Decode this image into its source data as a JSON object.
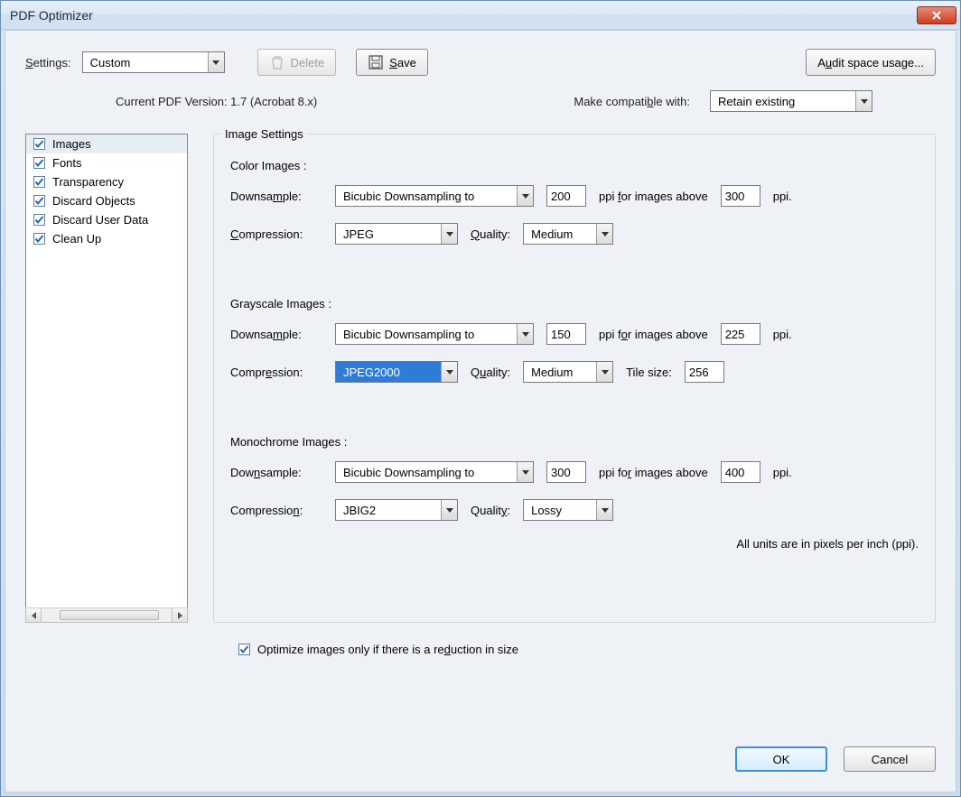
{
  "window": {
    "title": "PDF Optimizer"
  },
  "toolbar": {
    "settings_label": "Settings:",
    "settings_value": "Custom",
    "delete_label": "Delete",
    "save_label": "Save",
    "audit_label": "Audit space usage..."
  },
  "version": {
    "current_label": "Current PDF Version: 1.7 (Acrobat 8.x)",
    "compat_label": "Make compatible with:",
    "compat_value": "Retain existing"
  },
  "sidebar": {
    "items": [
      {
        "label": "Images",
        "checked": true,
        "selected": true
      },
      {
        "label": "Fonts",
        "checked": true,
        "selected": false
      },
      {
        "label": "Transparency",
        "checked": true,
        "selected": false
      },
      {
        "label": "Discard Objects",
        "checked": true,
        "selected": false
      },
      {
        "label": "Discard User Data",
        "checked": true,
        "selected": false
      },
      {
        "label": "Clean Up",
        "checked": true,
        "selected": false
      }
    ]
  },
  "panel": {
    "title": "Image Settings",
    "color_h": "Color Images :",
    "gray_h": "Grayscale Images :",
    "mono_h": "Monochrome Images :",
    "downsample_label": "Downsample:",
    "compression_label": "Compression:",
    "quality_label": "Quality:",
    "tile_label": "Tile size:",
    "ppi_for": "ppi for images above",
    "ppi_suffix": "ppi.",
    "color": {
      "downsample": "Bicubic Downsampling to",
      "ppi": "200",
      "above": "300",
      "compression": "JPEG",
      "quality": "Medium"
    },
    "gray": {
      "downsample": "Bicubic Downsampling to",
      "ppi": "150",
      "above": "225",
      "compression": "JPEG2000",
      "quality": "Medium",
      "tile": "256"
    },
    "mono": {
      "downsample": "Bicubic Downsampling to",
      "ppi": "300",
      "above": "400",
      "compression": "JBIG2",
      "quality": "Lossy"
    },
    "units_note": "All units are in pixels per inch (ppi)."
  },
  "optimize_checkbox": {
    "label": "Optimize images only if there is a reduction in size",
    "checked": true
  },
  "footer": {
    "ok": "OK",
    "cancel": "Cancel"
  }
}
